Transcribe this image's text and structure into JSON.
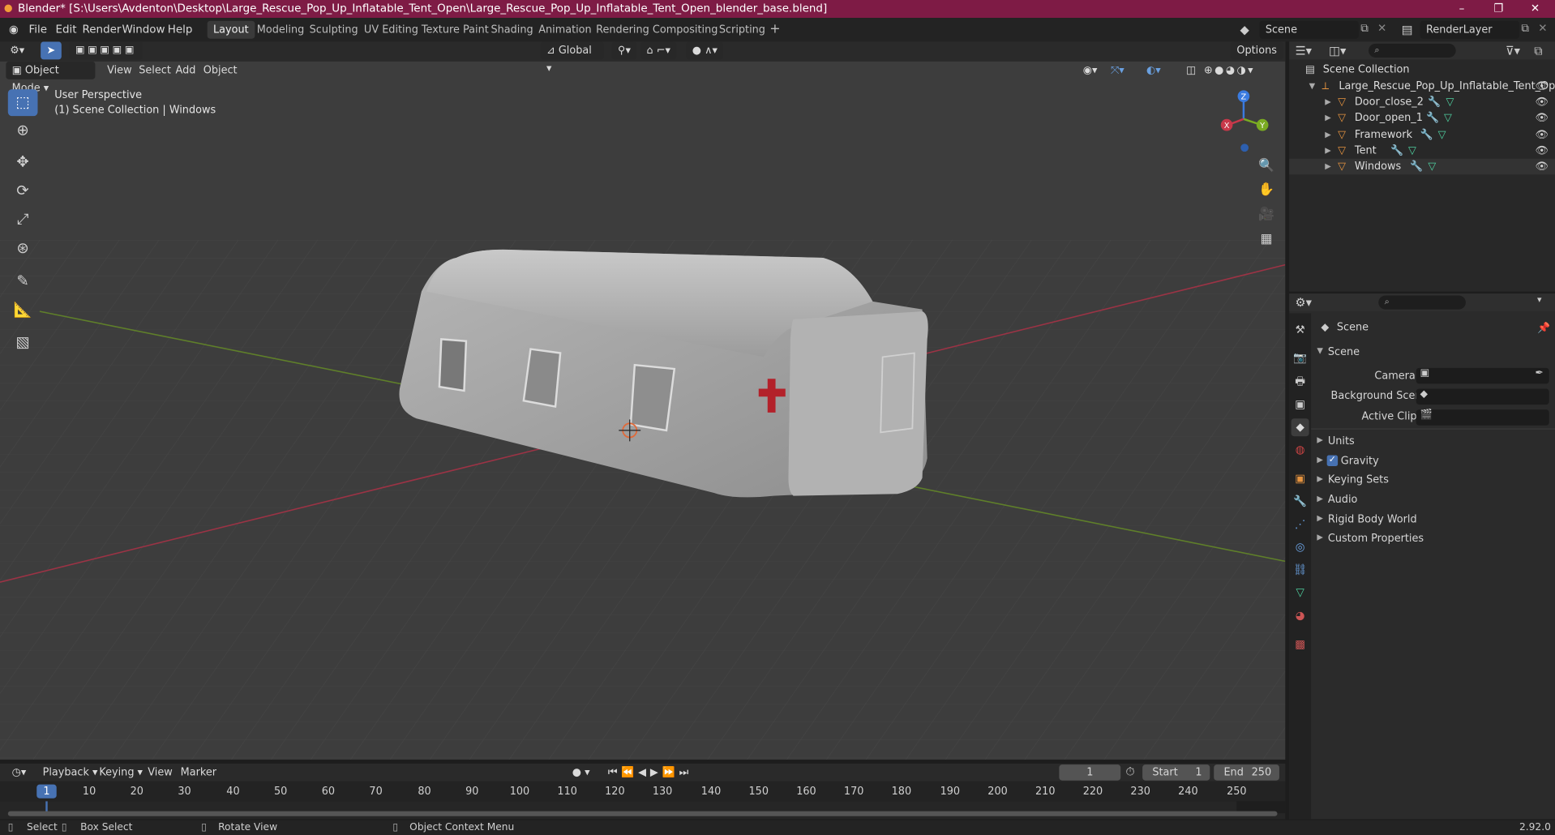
{
  "window": {
    "title": "Blender* [S:\\Users\\Avdenton\\Desktop\\Large_Rescue_Pop_Up_Inflatable_Tent_Open\\Large_Rescue_Pop_Up_Inflatable_Tent_Open_blender_base.blend]",
    "minimize": "–",
    "maximize": "❐",
    "close": "✕"
  },
  "menus": [
    "File",
    "Edit",
    "Render",
    "Window",
    "Help"
  ],
  "workspaces": [
    "Layout",
    "Modeling",
    "Sculpting",
    "UV Editing",
    "Texture Paint",
    "Shading",
    "Animation",
    "Rendering",
    "Compositing",
    "Scripting"
  ],
  "workspace_add": "+",
  "scene_selector": {
    "value": "Scene"
  },
  "renderlayer_selector": {
    "value": "RenderLayer"
  },
  "viewport": {
    "mode": "Object Mode",
    "header_menus": [
      "View",
      "Select",
      "Add",
      "Object"
    ],
    "transform_orientation": "Global",
    "options": "Options",
    "overlay_text": "User Perspective",
    "overlay_sub": "(1) Scene Collection | Windows",
    "gizmo": {
      "x": "X",
      "y": "Y",
      "z": "Z"
    }
  },
  "outliner": {
    "root": "Scene Collection",
    "collection": "Large_Rescue_Pop_Up_Inflatable_Tent_Open",
    "objects": [
      "Door_close_2",
      "Door_open_1",
      "Framework",
      "Tent",
      "Windows"
    ]
  },
  "properties": {
    "header": "Scene",
    "panel": "Scene",
    "camera_label": "Camera",
    "bg_scene_label": "Background Scene",
    "active_clip_label": "Active Clip",
    "sections": [
      "Units",
      "Gravity",
      "Keying Sets",
      "Audio",
      "Rigid Body World",
      "Custom Properties"
    ],
    "gravity_checked": true
  },
  "timeline": {
    "menus": [
      "Playback",
      "Keying",
      "View",
      "Marker"
    ],
    "current_frame": "1",
    "start_label": "Start",
    "start": "1",
    "end_label": "End",
    "end": "250",
    "ticks": [
      "1",
      "10",
      "20",
      "30",
      "40",
      "50",
      "60",
      "70",
      "80",
      "90",
      "100",
      "110",
      "120",
      "130",
      "140",
      "150",
      "160",
      "170",
      "180",
      "190",
      "200",
      "210",
      "220",
      "230",
      "240",
      "250"
    ]
  },
  "status": {
    "select": "Select",
    "box_select": "Box Select",
    "rotate": "Rotate View",
    "context_menu": "Object Context Menu",
    "version": "2.92.0"
  },
  "colors": {
    "titlebar": "#7e1b45",
    "accent": "#4772b3",
    "x_axis": "#c8384a",
    "y_axis": "#7aab22",
    "z_axis": "#3a7be0"
  }
}
